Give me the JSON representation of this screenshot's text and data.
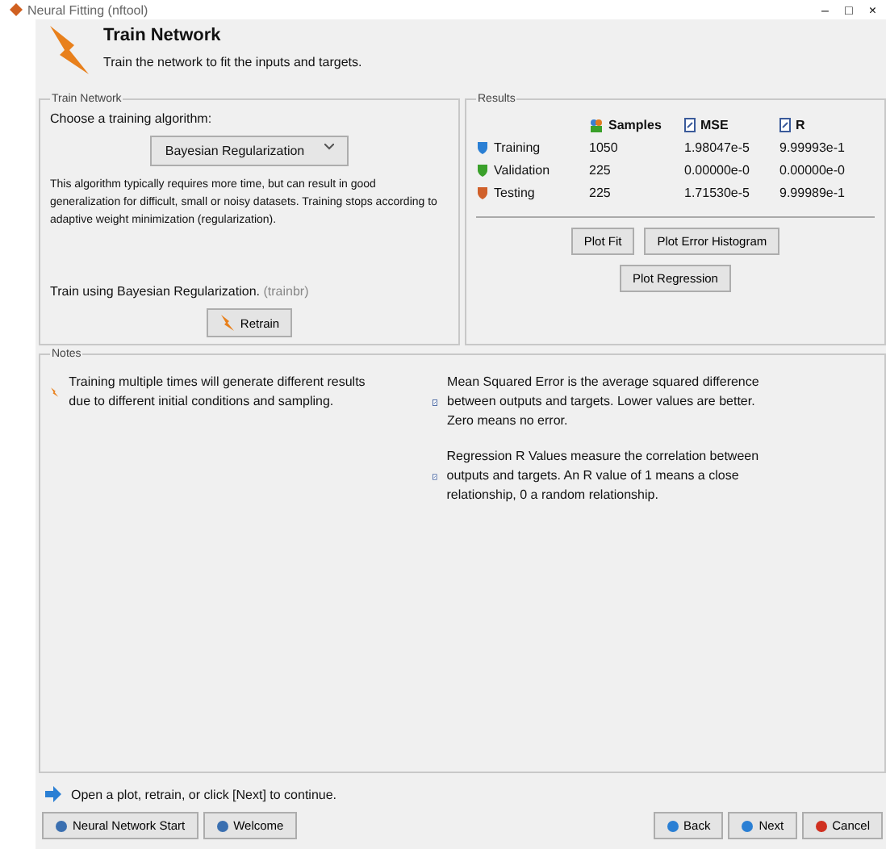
{
  "window": {
    "title": "Neural Fitting (nftool)",
    "controls": [
      "–",
      "□",
      "×"
    ]
  },
  "header": {
    "title": "Train Network",
    "subtitle": "Train the network to fit the inputs and targets."
  },
  "train_panel": {
    "legend": "Train Network",
    "prompt": "Choose a training algorithm:",
    "algorithm": "Bayesian Regularization",
    "description": "This algorithm typically requires more time, but can result in good generalization for difficult, small or noisy datasets. Training stops according to adaptive weight minimization (regularization).",
    "train_label": "Train using Bayesian Regularization.",
    "train_hint": "(trainbr)",
    "retrain_button": "Retrain"
  },
  "results": {
    "legend": "Results",
    "columns": [
      "Samples",
      "MSE",
      "R"
    ],
    "rows": [
      {
        "label": "Training",
        "color": "#2a7fd4",
        "values": [
          "1050",
          "1.98047e-5",
          "9.99993e-1"
        ]
      },
      {
        "label": "Validation",
        "color": "#3aa02a",
        "values": [
          "225",
          "0.00000e-0",
          "0.00000e-0"
        ]
      },
      {
        "label": "Testing",
        "color": "#d0602a",
        "values": [
          "225",
          "1.71530e-5",
          "9.99989e-1"
        ]
      }
    ],
    "buttons": [
      "Plot Fit",
      "Plot Error Histogram",
      "Plot Regression"
    ]
  },
  "notes": {
    "legend": "Notes",
    "left": [
      "Training multiple times will generate different results due to different initial conditions and sampling."
    ],
    "right": [
      "Mean Squared Error is the average squared difference between outputs and targets. Lower values are better. Zero means no error.",
      "Regression R Values measure the correlation between outputs and targets. An R value of 1 means a close relationship, 0 a random relationship."
    ]
  },
  "status": "Open a plot, retrain, or click [Next] to continue.",
  "nav_left": [
    "Neural Network Start",
    "Welcome"
  ],
  "nav_right": [
    "Back",
    "Next",
    "Cancel"
  ]
}
